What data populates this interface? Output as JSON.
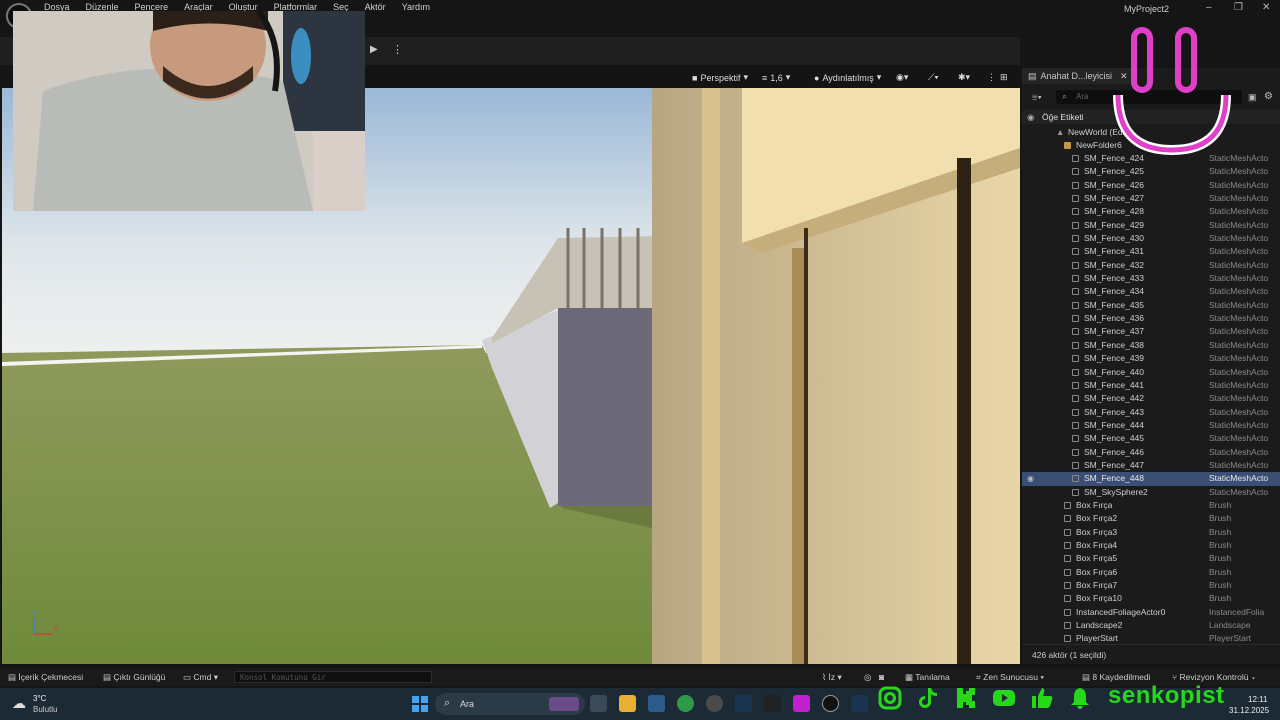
{
  "menubar": {
    "items": [
      "Dosya",
      "Düzenle",
      "Pencere",
      "Araçlar",
      "Oluştur",
      "Platformlar",
      "Seç",
      "Aktör",
      "Yardım"
    ],
    "project_name": "MyProject2"
  },
  "viewport_toolbar": {
    "perspective": "Perspektif",
    "speed": "1,6",
    "lit": "Aydınlatılmış"
  },
  "outliner": {
    "tab_title": "Anahat D...leyicisi",
    "search_placeholder": "Ara",
    "column_label": "Öğe Etiketi",
    "world": "NewWorld (Edito",
    "folder": "NewFolder6",
    "rows": [
      {
        "name": "SM_Fence_424",
        "type": "StaticMeshActo"
      },
      {
        "name": "SM_Fence_425",
        "type": "StaticMeshActo"
      },
      {
        "name": "SM_Fence_426",
        "type": "StaticMeshActo"
      },
      {
        "name": "SM_Fence_427",
        "type": "StaticMeshActo"
      },
      {
        "name": "SM_Fence_428",
        "type": "StaticMeshActo"
      },
      {
        "name": "SM_Fence_429",
        "type": "StaticMeshActo"
      },
      {
        "name": "SM_Fence_430",
        "type": "StaticMeshActo"
      },
      {
        "name": "SM_Fence_431",
        "type": "StaticMeshActo"
      },
      {
        "name": "SM_Fence_432",
        "type": "StaticMeshActo"
      },
      {
        "name": "SM_Fence_433",
        "type": "StaticMeshActo"
      },
      {
        "name": "SM_Fence_434",
        "type": "StaticMeshActo"
      },
      {
        "name": "SM_Fence_435",
        "type": "StaticMeshActo"
      },
      {
        "name": "SM_Fence_436",
        "type": "StaticMeshActo"
      },
      {
        "name": "SM_Fence_437",
        "type": "StaticMeshActo"
      },
      {
        "name": "SM_Fence_438",
        "type": "StaticMeshActo"
      },
      {
        "name": "SM_Fence_439",
        "type": "StaticMeshActo"
      },
      {
        "name": "SM_Fence_440",
        "type": "StaticMeshActo"
      },
      {
        "name": "SM_Fence_441",
        "type": "StaticMeshActo"
      },
      {
        "name": "SM_Fence_442",
        "type": "StaticMeshActo"
      },
      {
        "name": "SM_Fence_443",
        "type": "StaticMeshActo"
      },
      {
        "name": "SM_Fence_444",
        "type": "StaticMeshActo"
      },
      {
        "name": "SM_Fence_445",
        "type": "StaticMeshActo"
      },
      {
        "name": "SM_Fence_446",
        "type": "StaticMeshActo"
      },
      {
        "name": "SM_Fence_447",
        "type": "StaticMeshActo"
      },
      {
        "name": "SM_Fence_448",
        "type": "StaticMeshActo",
        "selected": true
      },
      {
        "name": "SM_SkySphere2",
        "type": "StaticMeshActo"
      }
    ],
    "brush_rows": [
      {
        "name": "Box Fırça",
        "type": "Brush"
      },
      {
        "name": "Box Fırça2",
        "type": "Brush"
      },
      {
        "name": "Box Fırça3",
        "type": "Brush"
      },
      {
        "name": "Box Fırça4",
        "type": "Brush"
      },
      {
        "name": "Box Fırça5",
        "type": "Brush"
      },
      {
        "name": "Box Fırça6",
        "type": "Brush"
      },
      {
        "name": "Box Fırça7",
        "type": "Brush"
      },
      {
        "name": "Box Fırça10",
        "type": "Brush"
      },
      {
        "name": "InstancedFoliageActor0",
        "type": "InstancedFolia"
      },
      {
        "name": "Landscape2",
        "type": "Landscape"
      },
      {
        "name": "PlayerStart",
        "type": "PlayerStart"
      }
    ],
    "status": "426 aktör (1 seçildi)"
  },
  "statusbar": {
    "content_drawer": "İçerik Çekmecesi",
    "output_log": "Çıktı Günlüğü",
    "cmd": "Cmd",
    "console_placeholder": "Konsol Komutunu Gir",
    "trace": "İz",
    "diagnostics": "Tanılama",
    "zen": "Zen Sunucusu",
    "unsaved": "8 Kaydedilmedi",
    "revision": "Revizyon Kontrolü"
  },
  "taskbar": {
    "temperature": "3°C",
    "weather": "Bulutlu",
    "search_placeholder": "Ara",
    "time": "12:11",
    "date": "31.12.2025"
  },
  "overlay": {
    "brand": "senkopist"
  },
  "colors": {
    "accent_pink": "#e040c8",
    "brand_green": "#27d81a",
    "selection": "#3b4f74"
  }
}
